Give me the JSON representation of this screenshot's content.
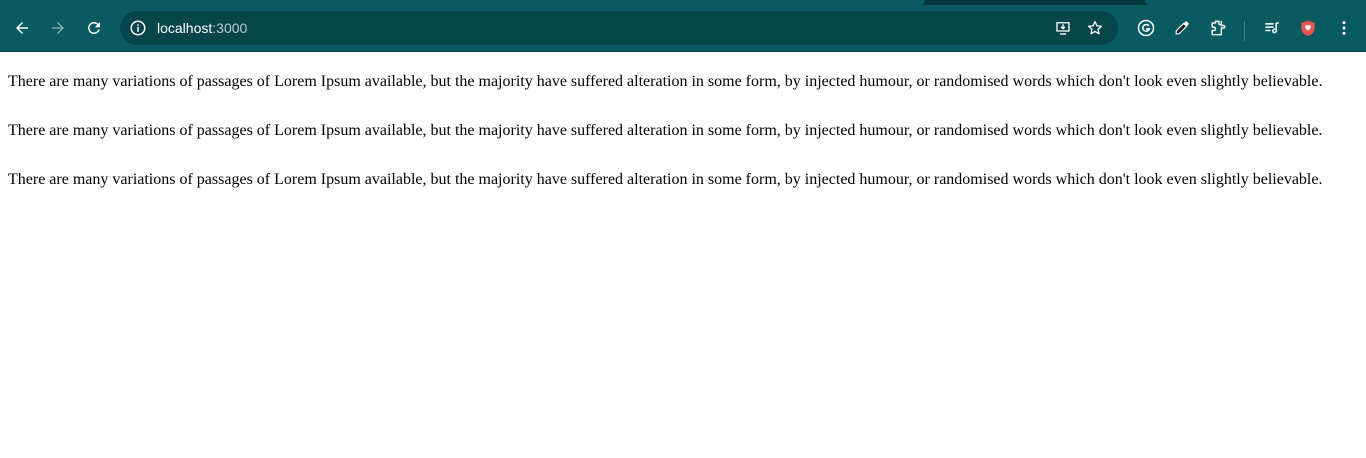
{
  "browser": {
    "url_host": "localhost",
    "url_port": ":3000",
    "icons": [
      "back-icon",
      "forward-icon",
      "reload-icon",
      "site-info-icon",
      "install-app-icon",
      "bookmark-star-icon",
      "grammarly-icon",
      "eyedropper-icon",
      "extensions-icon",
      "reading-list-icon",
      "profile-shield-icon",
      "menu-icon"
    ],
    "colors": {
      "toolbar": "#0a5a62",
      "omnibox": "#07454c",
      "accent": "#e8574f"
    }
  },
  "page": {
    "paragraphs": [
      "There are many variations of passages of Lorem Ipsum available, but the majority have suffered alteration in some form, by injected humour, or randomised words which don't look even slightly believable.",
      "There are many variations of passages of Lorem Ipsum available, but the majority have suffered alteration in some form, by injected humour, or randomised words which don't look even slightly believable.",
      "There are many variations of passages of Lorem Ipsum available, but the majority have suffered alteration in some form, by injected humour, or randomised words which don't look even slightly believable."
    ]
  }
}
